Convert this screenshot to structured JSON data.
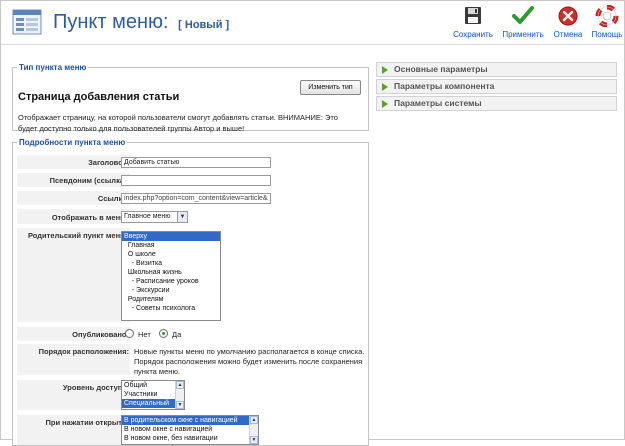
{
  "header": {
    "title": "Пункт меню:",
    "status": "[ Новый ]"
  },
  "toolbar": {
    "save": "Сохранить",
    "apply": "Применить",
    "cancel": "Отмена",
    "help": "Помощь"
  },
  "type_box": {
    "legend": "Тип пункта меню",
    "heading": "Страница добавления статьи",
    "description": "Отображает страницу, на которой пользователи смогут добавлять статьи. ВНИМАНИЕ: Это будет доступно только для пользователей группы Автор и выше!",
    "change_button": "Изменить тип"
  },
  "details": {
    "legend": "Подробности пункта меню",
    "title_label": "Заголовок:",
    "title_value": "Добавить статью",
    "alias_label": "Псевдоним (ссылка):",
    "alias_value": "",
    "link_label": "Ссылка:",
    "link_value": "index.php?option=com_content&view=article&",
    "menu_label": "Отображать в меню:",
    "menu_value": "Главное меню",
    "parent_label": "Родительский пункт меню:",
    "parent_items": [
      "Вверху",
      "  Главная",
      "  О школе",
      "    - Визитка",
      "  Школьная жизнь",
      "    - Расписание уроков",
      "    - Экскурсии",
      "  Родителям",
      "    - Советы психолога"
    ],
    "published_label": "Опубликовано:",
    "published_no": "Нет",
    "published_yes": "Да",
    "published_value": "Да",
    "order_label": "Порядок расположения:",
    "order_note": "Новые пункты меню по умолчанию располагается в конце списка. Порядок расположения можно будет изменить после сохранения пункта меню.",
    "access_label": "Уровень доступа:",
    "access_items": [
      "Общий",
      "Участники",
      "Специальный"
    ],
    "access_selected": "Специальный",
    "open_label": "При нажатии открыть:",
    "open_items": [
      "В родительском окне с навигацией",
      "В новом окне с навигацией",
      "В новом окне, без навигации"
    ],
    "open_selected": "В родительском окне с навигацией"
  },
  "params": {
    "basic": "Основные параметры",
    "component": "Параметры компонента",
    "system": "Параметры системы"
  },
  "colors": {
    "title_blue": "#2d5d9a",
    "accent_green": "#5aa02c",
    "selection": "#3169c6"
  }
}
